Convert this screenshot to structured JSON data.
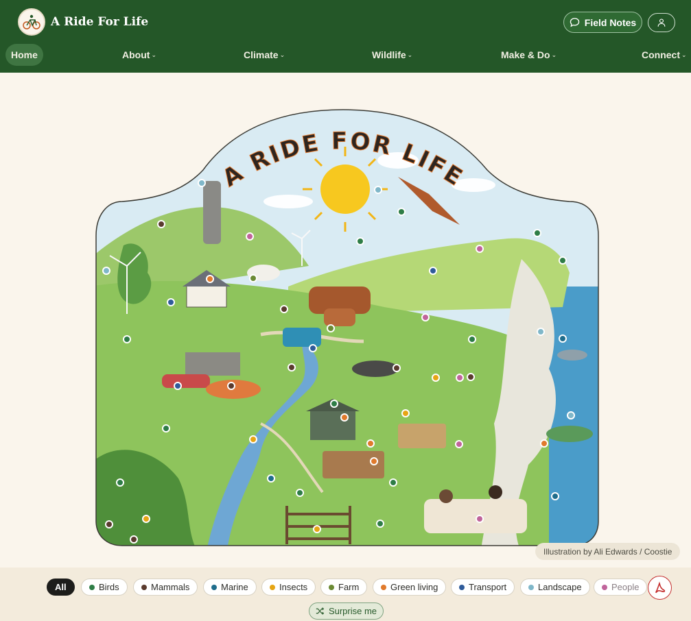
{
  "brand": {
    "name": "A Ride For Life",
    "logo_text": "A RIDE FOR LIFE"
  },
  "header": {
    "field_notes_label": "Field Notes"
  },
  "nav": [
    {
      "label": "Home",
      "dropdown": false
    },
    {
      "label": "About",
      "dropdown": true
    },
    {
      "label": "Climate",
      "dropdown": true
    },
    {
      "label": "Wildlife",
      "dropdown": true
    },
    {
      "label": "Make & Do",
      "dropdown": true
    },
    {
      "label": "Connect",
      "dropdown": true
    }
  ],
  "illustration": {
    "title": "A RIDE FOR LIFE",
    "credit": "Illustration by Ali Edwards / Coostie"
  },
  "filters": {
    "all_label": "All",
    "categories": [
      {
        "label": "Birds",
        "color": "#2e7d46"
      },
      {
        "label": "Mammals",
        "color": "#5a3b2e"
      },
      {
        "label": "Marine",
        "color": "#1f6d8c"
      },
      {
        "label": "Insects",
        "color": "#e6a514"
      },
      {
        "label": "Farm",
        "color": "#6b8a34"
      },
      {
        "label": "Green living",
        "color": "#e07a2c"
      },
      {
        "label": "Transport",
        "color": "#2f5b9a"
      },
      {
        "label": "Landscape",
        "color": "#7fb7c9"
      },
      {
        "label": "People",
        "color": "#c0649b"
      }
    ],
    "surprise_label": "Surprise me"
  },
  "colors": {
    "header": "#245728",
    "background": "#faf5ec",
    "pdf": "#c42e2e"
  },
  "icons": [
    "chat-bubble-icon",
    "user-icon",
    "chevron-down-icon",
    "shuffle-icon",
    "pdf-icon"
  ]
}
